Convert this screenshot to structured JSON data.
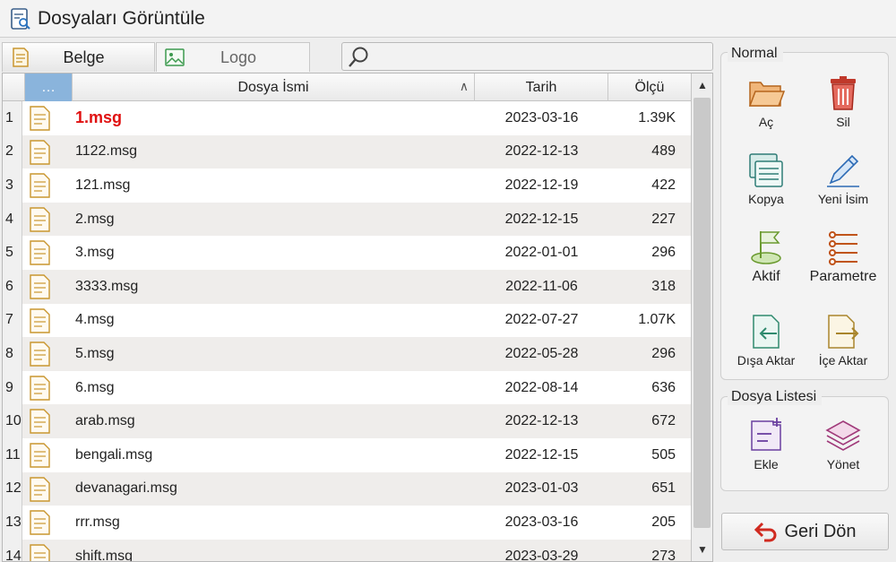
{
  "window": {
    "title": "Dosyaları Görüntüle"
  },
  "tabs": [
    {
      "label": "Belge",
      "active": true
    },
    {
      "label": "Logo",
      "active": false
    }
  ],
  "search": {
    "placeholder": ""
  },
  "table": {
    "columns": {
      "selector": "…",
      "name": "Dosya İsmi",
      "date": "Tarih",
      "size": "Ölçü"
    },
    "sort": "ascending",
    "rows": [
      {
        "num": "1",
        "name": "1.msg",
        "date": "2023-03-16",
        "size": "1.39K",
        "highlight": true
      },
      {
        "num": "2",
        "name": "1122.msg",
        "date": "2022-12-13",
        "size": "489"
      },
      {
        "num": "3",
        "name": "121.msg",
        "date": "2022-12-19",
        "size": "422"
      },
      {
        "num": "4",
        "name": "2.msg",
        "date": "2022-12-15",
        "size": "227"
      },
      {
        "num": "5",
        "name": "3.msg",
        "date": "2022-01-01",
        "size": "296"
      },
      {
        "num": "6",
        "name": "3333.msg",
        "date": "2022-11-06",
        "size": "318"
      },
      {
        "num": "7",
        "name": "4.msg",
        "date": "2022-07-27",
        "size": "1.07K"
      },
      {
        "num": "8",
        "name": "5.msg",
        "date": "2022-05-28",
        "size": "296"
      },
      {
        "num": "9",
        "name": "6.msg",
        "date": "2022-08-14",
        "size": "636"
      },
      {
        "num": "10",
        "name": "arab.msg",
        "date": "2022-12-13",
        "size": "672"
      },
      {
        "num": "11",
        "name": "bengali.msg",
        "date": "2022-12-15",
        "size": "505"
      },
      {
        "num": "12",
        "name": "devanagari.msg",
        "date": "2023-01-03",
        "size": "651"
      },
      {
        "num": "13",
        "name": "rrr.msg",
        "date": "2023-03-16",
        "size": "205"
      },
      {
        "num": "14",
        "name": "shift.msg",
        "date": "2023-03-29",
        "size": "273"
      }
    ]
  },
  "panel": {
    "normal": {
      "title": "Normal",
      "actions": {
        "open": "Aç",
        "delete": "Sil",
        "copy": "Kopya",
        "rename": "Yeni İsim",
        "active": "Aktif",
        "parameter": "Parametre",
        "export": "Dışa Aktar",
        "import": "İçe Aktar"
      }
    },
    "file_list": {
      "title": "Dosya Listesi",
      "actions": {
        "add": "Ekle",
        "manage": "Yönet"
      }
    },
    "back": "Geri Dön"
  },
  "colors": {
    "accent_header": "#8ab4dc",
    "highlight_text": "#e01010"
  }
}
